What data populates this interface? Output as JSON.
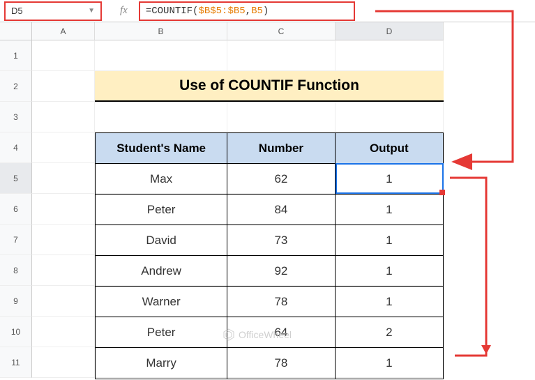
{
  "cell_reference": "D5",
  "formula": {
    "full": "=COUNTIF($B$5:$B5,B5)",
    "eq": "=",
    "fn": "COUNTIF",
    "open": "(",
    "range": "$B$5:$B5",
    "comma": ",",
    "ref": "B5",
    "close": ")"
  },
  "columns": [
    "A",
    "B",
    "C",
    "D"
  ],
  "rows": [
    "1",
    "2",
    "3",
    "4",
    "5",
    "6",
    "7",
    "8",
    "9",
    "10",
    "11"
  ],
  "title": "Use of COUNTIF Function",
  "table": {
    "headers": [
      "Student's Name",
      "Number",
      "Output"
    ],
    "data": [
      {
        "name": "Max",
        "number": "62",
        "output": "1"
      },
      {
        "name": "Peter",
        "number": "84",
        "output": "1"
      },
      {
        "name": "David",
        "number": "73",
        "output": "1"
      },
      {
        "name": "Andrew",
        "number": "92",
        "output": "1"
      },
      {
        "name": "Warner",
        "number": "78",
        "output": "1"
      },
      {
        "name": "Peter",
        "number": "64",
        "output": "2"
      },
      {
        "name": "Marry",
        "number": "78",
        "output": "1"
      }
    ]
  },
  "watermark": "OfficeWheel",
  "selected_row": "5",
  "selected_col": "D"
}
